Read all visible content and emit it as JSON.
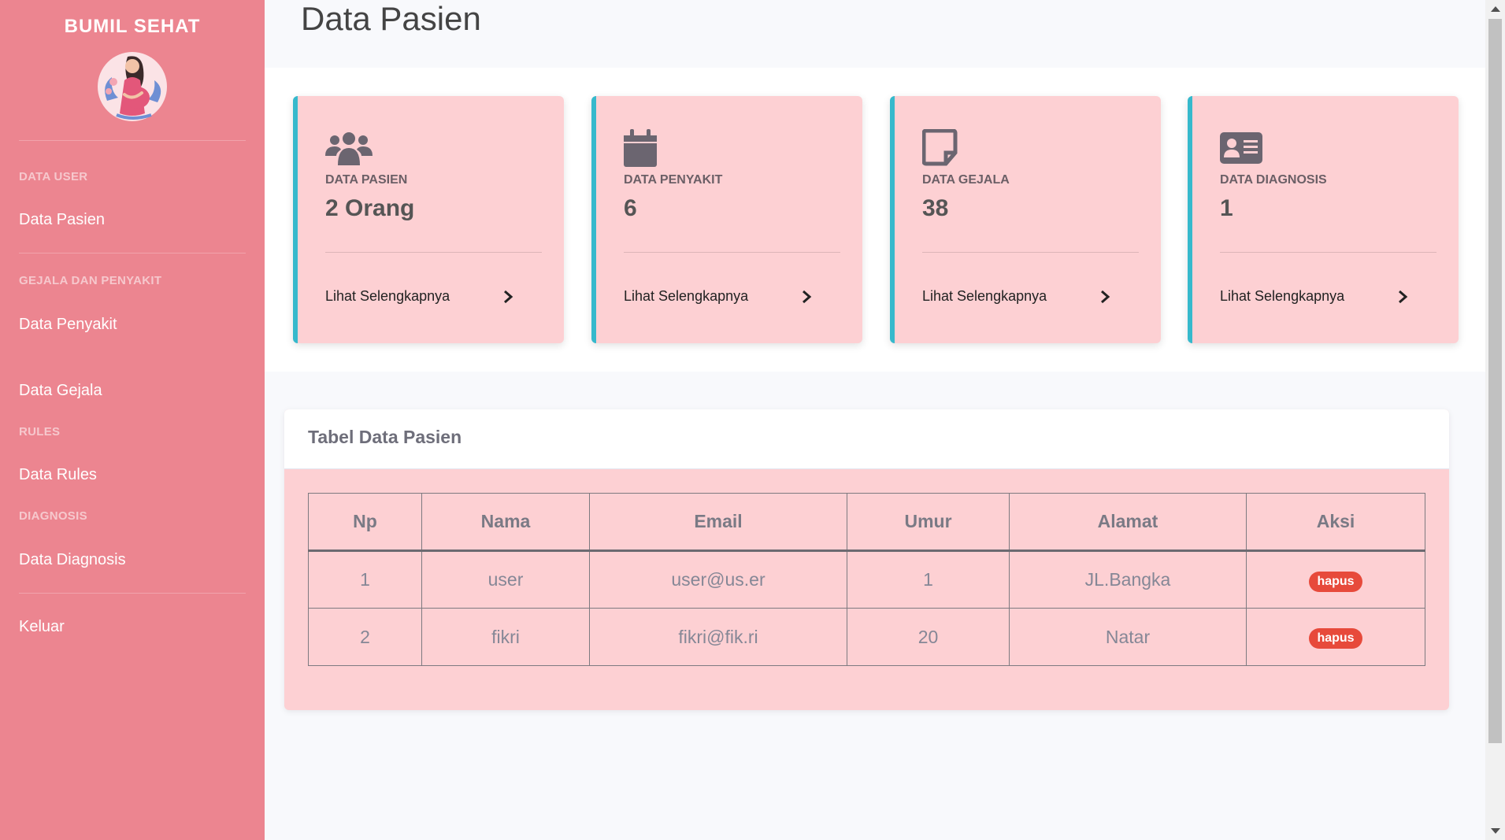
{
  "sidebar": {
    "brand": "BUMIL SEHAT",
    "sections": [
      {
        "heading": "DATA USER"
      },
      {
        "heading": "GEJALA DAN PENYAKIT"
      },
      {
        "heading": "RULES"
      },
      {
        "heading": "DIAGNOSIS"
      }
    ],
    "items": [
      {
        "label": "Data Pasien"
      },
      {
        "label": "Data Penyakit"
      },
      {
        "label": "Data Gejala"
      },
      {
        "label": "Data Rules"
      },
      {
        "label": "Data Diagnosis"
      },
      {
        "label": "Keluar"
      }
    ]
  },
  "page": {
    "title": "Data Pasien"
  },
  "cards": [
    {
      "label": "DATA PASIEN",
      "value": "2 Orang",
      "link": "Lihat Selengkapnya",
      "icon": "users-icon"
    },
    {
      "label": "DATA PENYAKIT",
      "value": "6",
      "link": "Lihat Selengkapnya",
      "icon": "calendar-icon"
    },
    {
      "label": "DATA GEJALA",
      "value": "38",
      "link": "Lihat Selengkapnya",
      "icon": "sticky-note-icon"
    },
    {
      "label": "DATA DIAGNOSIS",
      "value": "1",
      "link": "Lihat Selengkapnya",
      "icon": "id-card-icon"
    }
  ],
  "table": {
    "title": "Tabel Data Pasien",
    "columns": [
      "Np",
      "Nama",
      "Email",
      "Umur",
      "Alamat",
      "Aksi"
    ],
    "rows": [
      {
        "no": "1",
        "nama": "user",
        "email": "user@us.er",
        "umur": "1",
        "alamat": "JL.Bangka",
        "aksi": "hapus"
      },
      {
        "no": "2",
        "nama": "fikri",
        "email": "fikri@fik.ri",
        "umur": "20",
        "alamat": "Natar",
        "aksi": "hapus"
      }
    ]
  },
  "colors": {
    "sidebar": "#ec8590",
    "card_bg": "#fdd0d3",
    "card_accent": "#36b9cc",
    "badge_danger": "#e74a3b",
    "icon": "#6b6570"
  }
}
